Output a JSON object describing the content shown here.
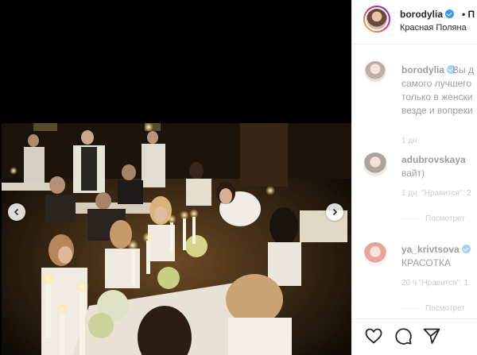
{
  "post": {
    "username": "borodylia",
    "follow_separator": "• П",
    "location": "Красная Поляна"
  },
  "comments": [
    {
      "username": "borodylia",
      "lines": [
        "Вы д",
        "самого лучшего",
        "только в женски",
        "везде и вопреки"
      ],
      "meta": "1 дн."
    },
    {
      "username": "adubrovskaya",
      "lines": [
        "вайт)"
      ],
      "meta": "1 дн.   \"Нравится\": 2",
      "replies": "Посмотрет"
    },
    {
      "username": "ya_krivtsova",
      "lines": [
        "КРАСОТКА"
      ],
      "meta": "20 ч   \"Нравится\": 1",
      "replies": "Посмотрет"
    }
  ],
  "actions": {
    "like_icon": "heart-icon",
    "comment_icon": "comment-icon",
    "share_icon": "share-icon"
  },
  "colors": {
    "verified": "#3897f0",
    "text": "#262626",
    "secondary": "#8e8e8e"
  }
}
